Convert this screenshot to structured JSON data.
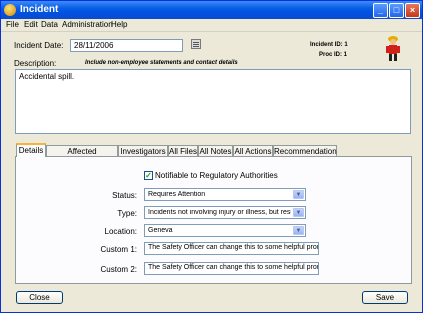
{
  "window": {
    "title": "Incident"
  },
  "menu": [
    "File",
    "Edit",
    "Data",
    "Administration",
    "Help"
  ],
  "header": {
    "incident_date_label": "Incident Date:",
    "incident_date_value": "28/11/2006",
    "incident_id": "Incident ID: 1",
    "proc_id": "Proc ID: 1",
    "description_label": "Description:",
    "description_hint": "Include non-employee statements and contact details",
    "description_value": "Accidental spill."
  },
  "tabs": [
    "Details",
    "Affected Employees",
    "Investigators",
    "All Files",
    "All Notes",
    "All Actions",
    "Recommendation"
  ],
  "details": {
    "notifiable_label": "Notifiable to Regulatory Authorities",
    "notifiable_checked": true,
    "status_label": "Status:",
    "status_value": "Requires Attention",
    "type_label": "Type:",
    "type_value": "Incidents not involving injury or illness, but resulting in",
    "location_label": "Location:",
    "location_value": "Geneva",
    "custom1_label": "Custom 1:",
    "custom1_value": "The Safety Officer can change this to some helpful prompts",
    "custom2_label": "Custom 2:",
    "custom2_value": "The Safety Officer can change this to some helpful prompts"
  },
  "buttons": {
    "close": "Close",
    "save": "Save"
  },
  "icons": {
    "app": "app-icon",
    "calendar": "calendar-icon",
    "mascot": "firefighter-icon"
  },
  "colors": {
    "titlebar": "#0a5de5",
    "tab_highlight": "#f8b33b",
    "check": "#21a121"
  }
}
